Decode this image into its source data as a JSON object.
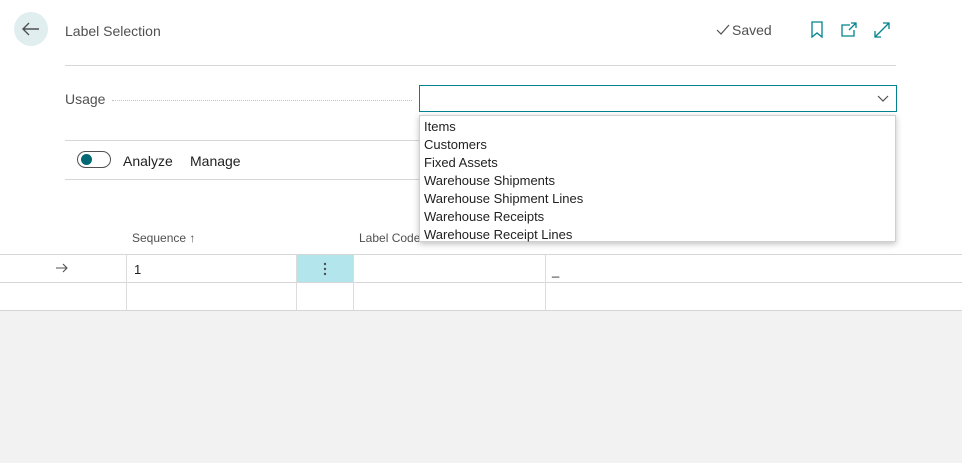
{
  "header": {
    "title": "Label Selection",
    "status": "Saved"
  },
  "usage": {
    "label": "Usage",
    "value": "",
    "options": [
      "Items",
      "Customers",
      "Fixed Assets",
      "Warehouse Shipments",
      "Warehouse Shipment Lines",
      "Warehouse Receipts",
      "Warehouse Receipt Lines"
    ]
  },
  "actions": {
    "analyze_label": "Analyze",
    "manage_label": "Manage"
  },
  "table": {
    "columns": [
      "Sequence ↑",
      "Label Code"
    ],
    "rows": [
      {
        "sequence": "1",
        "label_code": "",
        "description": "_"
      }
    ]
  },
  "colors": {
    "accent": "#00838f",
    "row_menu_bg": "#b3e6ec",
    "back_button_bg": "#e0eef0"
  }
}
